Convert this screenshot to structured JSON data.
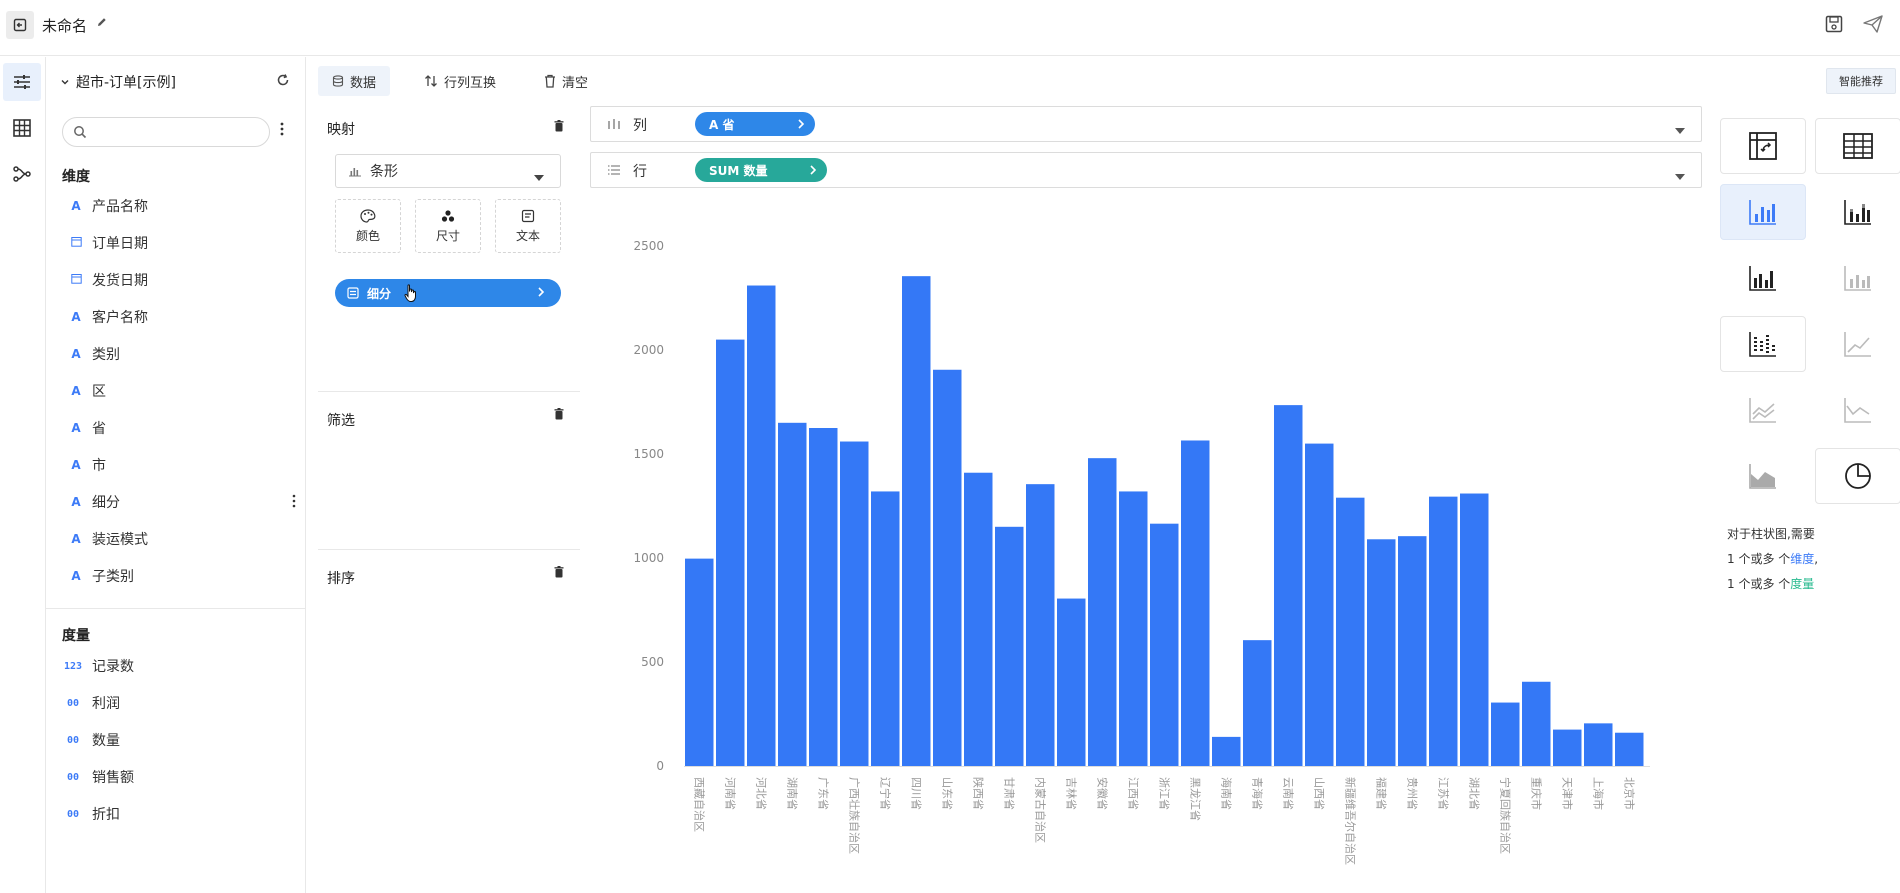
{
  "header": {
    "title": "未命名"
  },
  "dataset": {
    "name": "超市-订单[示例]",
    "search_placeholder": "",
    "dimensions_title": "维度",
    "dimensions": [
      {
        "type": "A",
        "label": "产品名称"
      },
      {
        "type": "date",
        "label": "订单日期"
      },
      {
        "type": "date",
        "label": "发货日期"
      },
      {
        "type": "A",
        "label": "客户名称"
      },
      {
        "type": "A",
        "label": "类别"
      },
      {
        "type": "A",
        "label": "区"
      },
      {
        "type": "A",
        "label": "省"
      },
      {
        "type": "A",
        "label": "市"
      },
      {
        "type": "A",
        "label": "细分"
      },
      {
        "type": "A",
        "label": "装运模式"
      },
      {
        "type": "A",
        "label": "子类别"
      }
    ],
    "measures_title": "度量",
    "measures": [
      {
        "type": "123",
        "label": "记录数"
      },
      {
        "type": "00",
        "label": "利润"
      },
      {
        "type": "00",
        "label": "数量"
      },
      {
        "type": "00",
        "label": "销售额"
      },
      {
        "type": "00",
        "label": "折扣"
      }
    ]
  },
  "tabs": {
    "data": "数据",
    "swap": "行列互换",
    "clear": "清空"
  },
  "config": {
    "mapping_label": "映射",
    "chart_type": "条形",
    "color_label": "颜色",
    "size_label": "尺寸",
    "text_label": "文本",
    "detail_pill": "细分",
    "filter_label": "筛选",
    "sort_label": "排序"
  },
  "shelves": {
    "columns_label": "列",
    "columns_pill": "A 省",
    "rows_label": "行",
    "rows_pill": "SUM 数量"
  },
  "colors": {
    "bar": "#3478f6",
    "accent": "#2e87e8",
    "measure_pill": "#27a89a",
    "dimension_pill": "#2e87e8"
  },
  "chart_type_panel": {
    "smart_button": "智能推荐",
    "hint_line1": "对于柱状图,需要",
    "hint_line2_prefix": "1 个或多 个",
    "hint_line2_keyword": "维度",
    "hint_line2_suffix": ",",
    "hint_line3_prefix": "1 个或多 个",
    "hint_line3_keyword": "度量"
  },
  "chart_data": {
    "type": "bar",
    "title": "",
    "xlabel": "",
    "ylabel": "",
    "ylim": [
      0,
      2500
    ],
    "yticks": [
      0,
      500,
      1000,
      1500,
      2000,
      2500
    ],
    "categories": [
      "西藏自治区",
      "河南省",
      "河北省",
      "湖南省",
      "广东省",
      "广西壮族自治区",
      "辽宁省",
      "四川省",
      "山东省",
      "陕西省",
      "甘肃省",
      "内蒙古自治区",
      "吉林省",
      "安徽省",
      "江西省",
      "浙江省",
      "黑龙江省",
      "海南省",
      "青海省",
      "云南省",
      "山西省",
      "新疆维吾尔自治区",
      "福建省",
      "贵州省",
      "江苏省",
      "湖北省",
      "宁夏回族自治区",
      "重庆市",
      "天津市",
      "上海市",
      "北京市"
    ],
    "values": [
      997,
      2050,
      2310,
      1650,
      1625,
      1560,
      1320,
      2355,
      1905,
      1410,
      1150,
      1355,
      805,
      1480,
      1320,
      1165,
      1565,
      140,
      605,
      1735,
      1550,
      1290,
      1090,
      1105,
      1295,
      1310,
      305,
      405,
      175,
      205,
      160
    ],
    "grid": false,
    "legend": "none"
  }
}
